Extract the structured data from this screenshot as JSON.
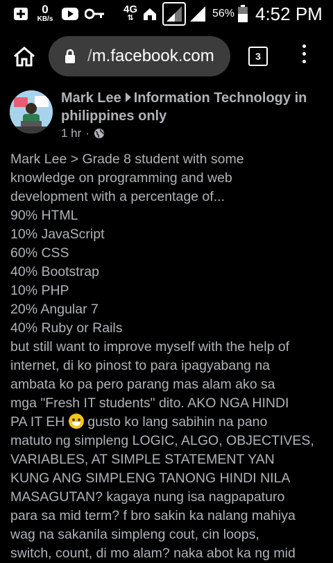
{
  "status_bar": {
    "net_speed": "0",
    "net_unit": "KB/s",
    "network_type": "4G",
    "battery": "56%",
    "time": "4:52 PM"
  },
  "browser": {
    "url_prefix": "/",
    "url": "m.facebook.com",
    "tab_count": "3"
  },
  "post": {
    "author": "Mark Lee",
    "group": "Information Technology in philippines only",
    "time": "1 hr",
    "lines": [
      "Mark Lee > Grade 8 student with some",
      "knowledge on programming and web",
      "development with a percentage of...",
      "90% HTML",
      "10% JavaScript",
      "60% CSS",
      "40% Bootstrap",
      "10% PHP",
      "20% Angular 7",
      "40% Ruby or Rails",
      "but still want to improve myself with the help of",
      "internet, di ko pinost to para ipagyabang na",
      "ambata ko pa pero parang mas alam ako sa",
      "mga \"Fresh IT students\" dito. AKO NGA HINDI",
      "PA IT EH",
      "gusto ko lang sabihin na pano",
      "matuto ng simpleng LOGIC, ALGO, OBJECTIVES,",
      "VARIABLES, AT SIMPLE STATEMENT YAN",
      "KUNG ANG SIMPLENG TANONG HINDI NILA",
      "MASAGUTAN? kagaya nung isa nagpapaturo",
      "para sa mid term? f bro sakin ka nalang mahiya",
      "wag na sakanila simpleng cout, cin loops,",
      "switch, count, di mo alam? naka abot ka ng mid"
    ]
  }
}
